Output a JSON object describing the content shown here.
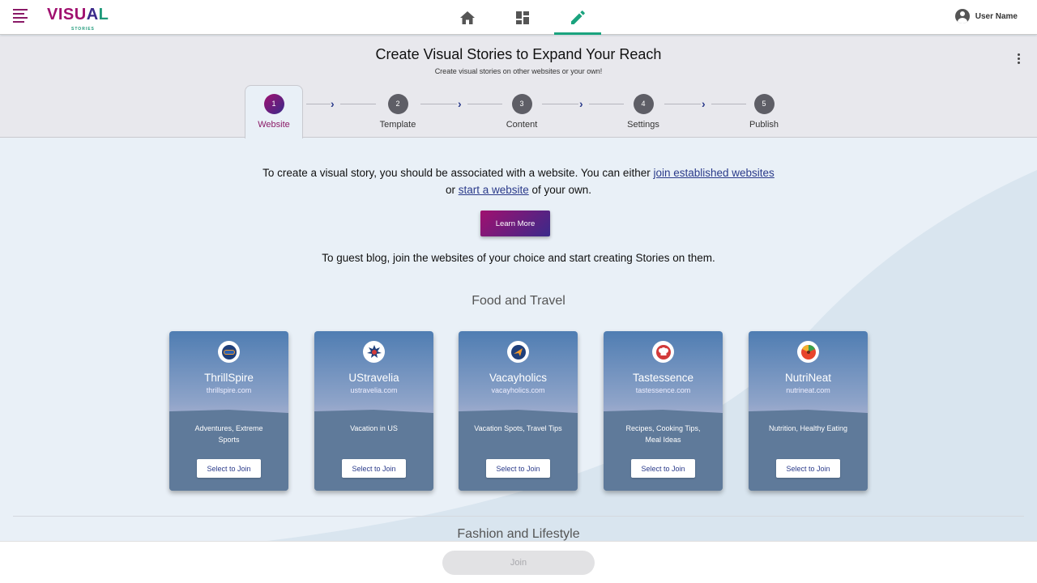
{
  "app": {
    "logo_text_1": "VISU",
    "logo_text_2": "A",
    "logo_text_3": "L",
    "logo_sub": "STORIES"
  },
  "nav": {
    "items": [
      {
        "icon": "home-icon",
        "active": false
      },
      {
        "icon": "dashboard-icon",
        "active": false
      },
      {
        "icon": "pencil-icon",
        "active": true
      }
    ]
  },
  "user": {
    "name": "User Name"
  },
  "header": {
    "title": "Create Visual Stories to Expand Your Reach",
    "subtitle": "Create visual stories on other websites or your own!"
  },
  "stepper": {
    "steps": [
      {
        "num": "1",
        "label": "Website",
        "active": true
      },
      {
        "num": "2",
        "label": "Template",
        "active": false
      },
      {
        "num": "3",
        "label": "Content",
        "active": false
      },
      {
        "num": "4",
        "label": "Settings",
        "active": false
      },
      {
        "num": "5",
        "label": "Publish",
        "active": false
      }
    ]
  },
  "intro": {
    "line1_pre": "To create a visual story, you should be associated with a website. You can either ",
    "link1": "join established websites",
    "line2_pre": "or ",
    "link2": "start a website",
    "line2_post": " of your own.",
    "learn_more": "Learn More",
    "guest": "To guest blog, join the websites of your choice and start creating Stories on them."
  },
  "categories": [
    {
      "title": "Food and Travel",
      "sites": [
        {
          "name": "ThrillSpire",
          "domain": "thrillspire.com",
          "tags": "Adventures, Extreme Sports",
          "button": "Select to Join",
          "icon": "goggles-icon"
        },
        {
          "name": "UStravelia",
          "domain": "ustravelia.com",
          "tags": "Vacation in US",
          "button": "Select to Join",
          "icon": "map-pin-icon"
        },
        {
          "name": "Vacayholics",
          "domain": "vacayholics.com",
          "tags": "Vacation Spots, Travel Tips",
          "button": "Select to Join",
          "icon": "plane-icon"
        },
        {
          "name": "Tastessence",
          "domain": "tastessence.com",
          "tags": "Recipes, Cooking Tips, Meal Ideas",
          "button": "Select to Join",
          "icon": "chef-hat-icon"
        },
        {
          "name": "NutriNeat",
          "domain": "nutrineat.com",
          "tags": "Nutrition, Healthy Eating",
          "button": "Select to Join",
          "icon": "fruit-icon"
        }
      ]
    },
    {
      "title": "Fashion and Lifestyle",
      "sites": []
    }
  ],
  "footer": {
    "join_label": "Join"
  },
  "colors": {
    "accent": "#1aa37e",
    "brand_start": "#a0106f",
    "brand_end": "#3a2a8a"
  }
}
